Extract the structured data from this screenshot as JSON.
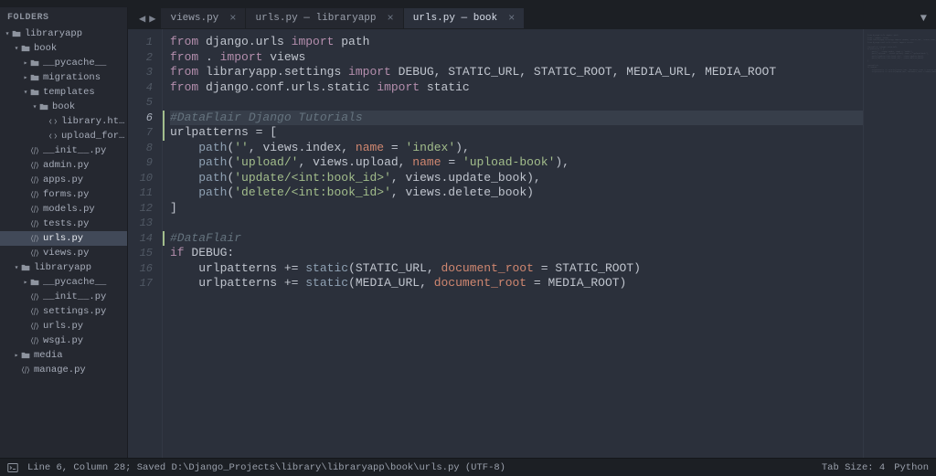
{
  "sidebar": {
    "title": "FOLDERS",
    "tree": [
      {
        "depth": 0,
        "arrow": "open",
        "icon": "folder",
        "label": "libraryapp",
        "sel": false
      },
      {
        "depth": 1,
        "arrow": "open",
        "icon": "folder",
        "label": "book",
        "sel": false
      },
      {
        "depth": 2,
        "arrow": "closed",
        "icon": "folder",
        "label": "__pycache__",
        "sel": false
      },
      {
        "depth": 2,
        "arrow": "closed",
        "icon": "folder",
        "label": "migrations",
        "sel": false
      },
      {
        "depth": 2,
        "arrow": "open",
        "icon": "folder",
        "label": "templates",
        "sel": false
      },
      {
        "depth": 3,
        "arrow": "open",
        "icon": "folder",
        "label": "book",
        "sel": false
      },
      {
        "depth": 4,
        "arrow": "none",
        "icon": "html",
        "label": "library.html",
        "sel": false
      },
      {
        "depth": 4,
        "arrow": "none",
        "icon": "html",
        "label": "upload_form.html",
        "sel": false
      },
      {
        "depth": 2,
        "arrow": "none",
        "icon": "py",
        "label": "__init__.py",
        "sel": false
      },
      {
        "depth": 2,
        "arrow": "none",
        "icon": "py",
        "label": "admin.py",
        "sel": false
      },
      {
        "depth": 2,
        "arrow": "none",
        "icon": "py",
        "label": "apps.py",
        "sel": false
      },
      {
        "depth": 2,
        "arrow": "none",
        "icon": "py",
        "label": "forms.py",
        "sel": false
      },
      {
        "depth": 2,
        "arrow": "none",
        "icon": "py",
        "label": "models.py",
        "sel": false
      },
      {
        "depth": 2,
        "arrow": "none",
        "icon": "py",
        "label": "tests.py",
        "sel": false
      },
      {
        "depth": 2,
        "arrow": "none",
        "icon": "py",
        "label": "urls.py",
        "sel": true
      },
      {
        "depth": 2,
        "arrow": "none",
        "icon": "py",
        "label": "views.py",
        "sel": false
      },
      {
        "depth": 1,
        "arrow": "open",
        "icon": "folder",
        "label": "libraryapp",
        "sel": false
      },
      {
        "depth": 2,
        "arrow": "closed",
        "icon": "folder",
        "label": "__pycache__",
        "sel": false
      },
      {
        "depth": 2,
        "arrow": "none",
        "icon": "py",
        "label": "__init__.py",
        "sel": false
      },
      {
        "depth": 2,
        "arrow": "none",
        "icon": "py",
        "label": "settings.py",
        "sel": false
      },
      {
        "depth": 2,
        "arrow": "none",
        "icon": "py",
        "label": "urls.py",
        "sel": false
      },
      {
        "depth": 2,
        "arrow": "none",
        "icon": "py",
        "label": "wsgi.py",
        "sel": false
      },
      {
        "depth": 1,
        "arrow": "closed",
        "icon": "folder",
        "label": "media",
        "sel": false
      },
      {
        "depth": 1,
        "arrow": "none",
        "icon": "py",
        "label": "manage.py",
        "sel": false
      }
    ]
  },
  "tabs": [
    {
      "label": "views.py",
      "active": false
    },
    {
      "label": "urls.py — libraryapp",
      "active": false
    },
    {
      "label": "urls.py — book",
      "active": true
    }
  ],
  "nav": {
    "back": "◀",
    "fwd": "▶",
    "menu": "▼"
  },
  "code": {
    "caret_line": 6,
    "marker_lines": [
      6,
      7,
      14
    ],
    "lines": [
      {
        "n": 1,
        "tokens": [
          [
            "from",
            "k-keyword"
          ],
          [
            " django.urls ",
            "k-ident"
          ],
          [
            "import",
            "k-keyword"
          ],
          [
            " path",
            "k-ident"
          ]
        ]
      },
      {
        "n": 2,
        "tokens": [
          [
            "from",
            "k-keyword"
          ],
          [
            " . ",
            "k-ident"
          ],
          [
            "import",
            "k-keyword"
          ],
          [
            " views",
            "k-ident"
          ]
        ]
      },
      {
        "n": 3,
        "tokens": [
          [
            "from",
            "k-keyword"
          ],
          [
            " libraryapp.settings ",
            "k-ident"
          ],
          [
            "import",
            "k-keyword"
          ],
          [
            " DEBUG, STATIC_URL, STATIC_ROOT, MEDIA_URL, MEDIA_ROOT",
            "k-const"
          ]
        ]
      },
      {
        "n": 4,
        "tokens": [
          [
            "from",
            "k-keyword"
          ],
          [
            " django.conf.urls.static ",
            "k-ident"
          ],
          [
            "import",
            "k-keyword"
          ],
          [
            " static",
            "k-ident"
          ]
        ]
      },
      {
        "n": 5,
        "tokens": [
          [
            "",
            ""
          ]
        ]
      },
      {
        "n": 6,
        "tokens": [
          [
            "#DataFlair Django Tutorials",
            "k-comment"
          ]
        ]
      },
      {
        "n": 7,
        "tokens": [
          [
            "urlpatterns ",
            "k-ident"
          ],
          [
            "=",
            "k-op"
          ],
          [
            " [",
            "k-op"
          ]
        ]
      },
      {
        "n": 8,
        "tokens": [
          [
            "    ",
            "k-ident"
          ],
          [
            "path",
            "k-func"
          ],
          [
            "(",
            "k-op"
          ],
          [
            "''",
            "k-string"
          ],
          [
            ", views.index, ",
            "k-ident"
          ],
          [
            "name",
            "k-arg"
          ],
          [
            " ",
            "k-ident"
          ],
          [
            "=",
            "k-op"
          ],
          [
            " ",
            "k-ident"
          ],
          [
            "'index'",
            "k-string"
          ],
          [
            "),",
            "k-op"
          ]
        ]
      },
      {
        "n": 9,
        "tokens": [
          [
            "    ",
            "k-ident"
          ],
          [
            "path",
            "k-func"
          ],
          [
            "(",
            "k-op"
          ],
          [
            "'upload/'",
            "k-string"
          ],
          [
            ", views.upload, ",
            "k-ident"
          ],
          [
            "name",
            "k-arg"
          ],
          [
            " ",
            "k-ident"
          ],
          [
            "=",
            "k-op"
          ],
          [
            " ",
            "k-ident"
          ],
          [
            "'upload-book'",
            "k-string"
          ],
          [
            "),",
            "k-op"
          ]
        ]
      },
      {
        "n": 10,
        "tokens": [
          [
            "    ",
            "k-ident"
          ],
          [
            "path",
            "k-func"
          ],
          [
            "(",
            "k-op"
          ],
          [
            "'update/<int:book_id>'",
            "k-string"
          ],
          [
            ", views.update_book),",
            "k-ident"
          ]
        ]
      },
      {
        "n": 11,
        "tokens": [
          [
            "    ",
            "k-ident"
          ],
          [
            "path",
            "k-func"
          ],
          [
            "(",
            "k-op"
          ],
          [
            "'delete/<int:book_id>'",
            "k-string"
          ],
          [
            ", views.delete_book)",
            "k-ident"
          ]
        ]
      },
      {
        "n": 12,
        "tokens": [
          [
            "]",
            "k-op"
          ]
        ]
      },
      {
        "n": 13,
        "tokens": [
          [
            "",
            ""
          ]
        ]
      },
      {
        "n": 14,
        "tokens": [
          [
            "#DataFlair",
            "k-comment"
          ]
        ]
      },
      {
        "n": 15,
        "tokens": [
          [
            "if",
            "k-keyword"
          ],
          [
            " DEBUG:",
            "k-ident"
          ]
        ]
      },
      {
        "n": 16,
        "tokens": [
          [
            "    urlpatterns ",
            "k-ident"
          ],
          [
            "+=",
            "k-op"
          ],
          [
            " ",
            "k-ident"
          ],
          [
            "static",
            "k-func"
          ],
          [
            "(STATIC_URL, ",
            "k-ident"
          ],
          [
            "document_root",
            "k-arg"
          ],
          [
            " ",
            "k-ident"
          ],
          [
            "=",
            "k-op"
          ],
          [
            " STATIC_ROOT)",
            "k-ident"
          ]
        ]
      },
      {
        "n": 17,
        "tokens": [
          [
            "    urlpatterns ",
            "k-ident"
          ],
          [
            "+=",
            "k-op"
          ],
          [
            " ",
            "k-ident"
          ],
          [
            "static",
            "k-func"
          ],
          [
            "(MEDIA_URL, ",
            "k-ident"
          ],
          [
            "document_root",
            "k-arg"
          ],
          [
            " ",
            "k-ident"
          ],
          [
            "=",
            "k-op"
          ],
          [
            " MEDIA_ROOT)",
            "k-ident"
          ]
        ]
      }
    ]
  },
  "status": {
    "left": "Line 6, Column 28; Saved D:\\Django_Projects\\library\\libraryapp\\book\\urls.py (UTF-8)",
    "tabsize": "Tab Size: 4",
    "lang": "Python"
  }
}
